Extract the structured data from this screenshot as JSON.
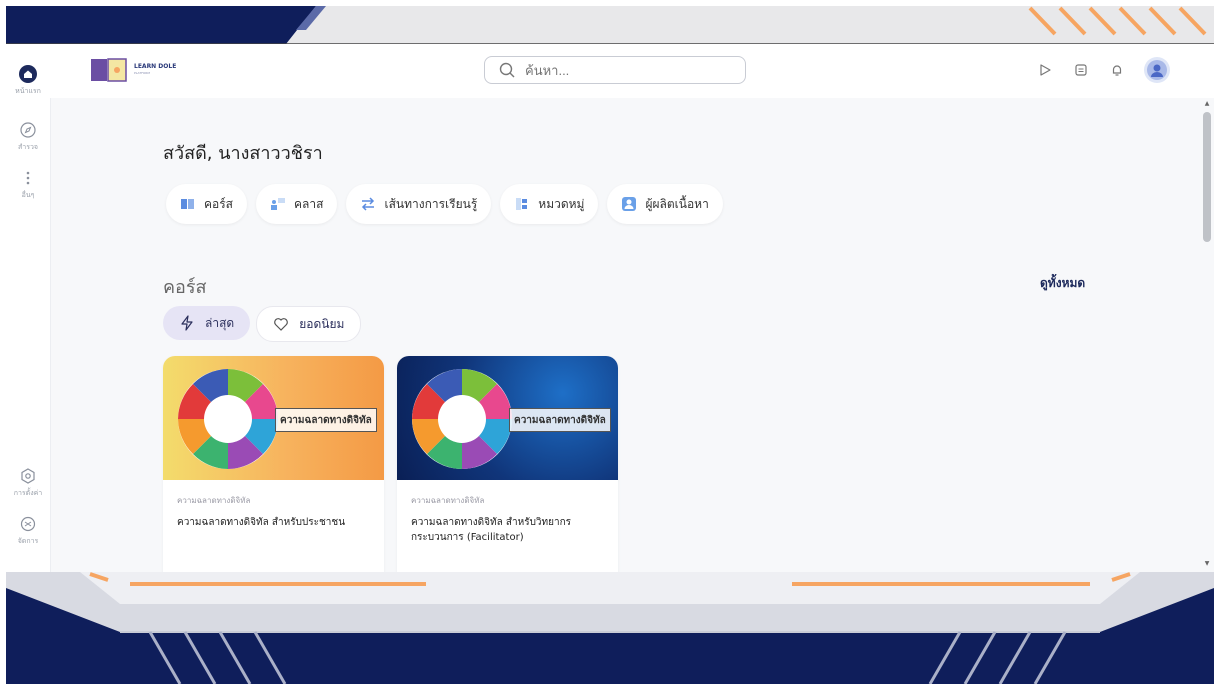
{
  "colors": {
    "frame_navy": "#0f1e5b",
    "accent_orange": "#f6a562",
    "brand_purple": "#6b4ea3"
  },
  "sidebar": {
    "items": [
      {
        "label": "หน้าแรก",
        "icon": "home-icon"
      },
      {
        "label": "สำรวจ",
        "icon": "compass-icon"
      },
      {
        "label": "อื่นๆ",
        "icon": "more-icon"
      },
      {
        "label": "การตั้งค่า",
        "icon": "settings-icon"
      },
      {
        "label": "จัดการ",
        "icon": "manage-icon"
      }
    ]
  },
  "header": {
    "logo_text": "LEARN DOLE",
    "logo_sub": "PLATFORM",
    "search_placeholder": "ค้นหา...",
    "icons": [
      "play-icon",
      "calendar-icon",
      "bell-icon",
      "user-avatar-icon"
    ]
  },
  "main": {
    "greeting": "สวัสดี, นางสาววชิรา",
    "chips": [
      {
        "label": "คอร์ส",
        "icon": "book-icon"
      },
      {
        "label": "คลาส",
        "icon": "class-icon"
      },
      {
        "label": "เส้นทางการเรียนรู้",
        "icon": "path-icon"
      },
      {
        "label": "หมวดหมู่",
        "icon": "category-icon"
      },
      {
        "label": "ผู้ผลิตเนื้อหา",
        "icon": "creator-icon"
      }
    ],
    "section_title": "คอร์ส",
    "see_all": "ดูทั้งหมด",
    "filters": [
      {
        "label": "ล่าสุด",
        "icon": "lightning-icon"
      },
      {
        "label": "ยอดนิยม",
        "icon": "heart-icon"
      }
    ],
    "cards": [
      {
        "banner": "ความฉลาดทางดิจิทัล",
        "category": "ความฉลาดทางดิจิทัล",
        "title": "ความฉลาดทางดิจิทัล สำหรับประชาชน"
      },
      {
        "banner": "ความฉลาดทางดิจิทัล",
        "category": "ความฉลาดทางดิจิทัล",
        "title": "ความฉลาดทางดิจิทัล สำหรับวิทยากรกระบวนการ (Facilitator)"
      }
    ]
  }
}
